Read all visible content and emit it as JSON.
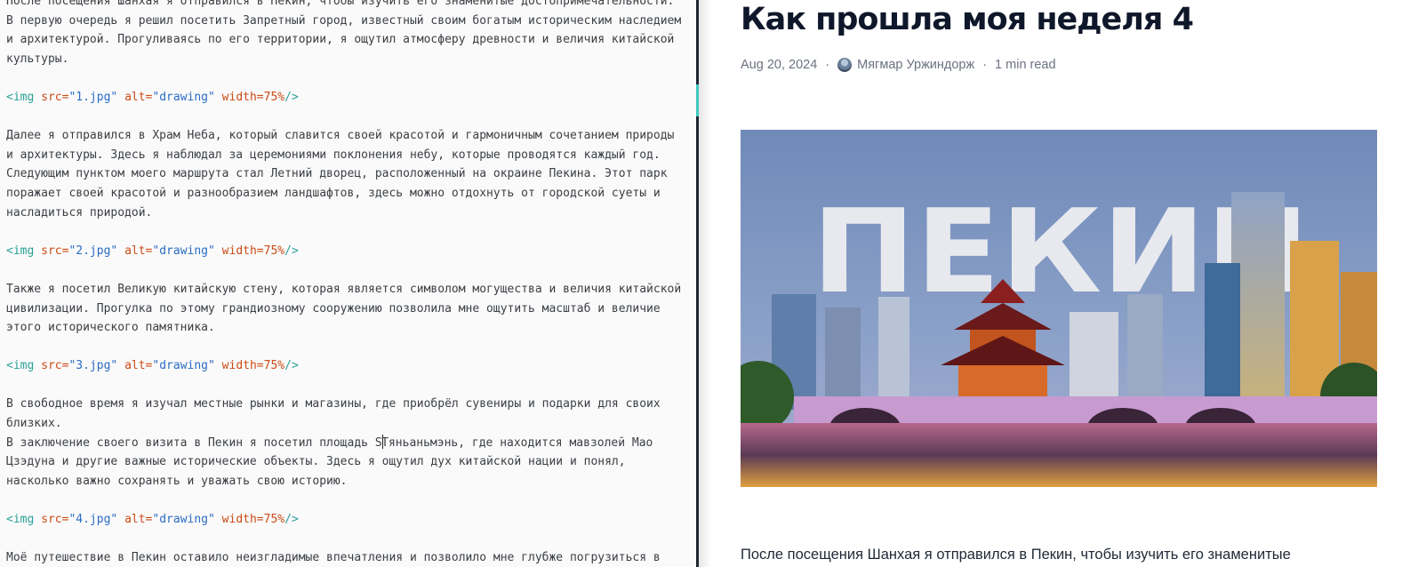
{
  "editor": {
    "lines": [
      [
        {
          "t": "plain",
          "v": "После посещения Шанхая я отправился в Пекин, чтобы изучить его знаменитые достопримечательности."
        }
      ],
      [
        {
          "t": "plain",
          "v": "В первую очередь я решил посетить Запретный город, известный своим богатым историческим наследием"
        }
      ],
      [
        {
          "t": "plain",
          "v": "и архитектурой. Прогуливаясь по его территории, я ощутил атмосферу древности и величия китайской"
        }
      ],
      [
        {
          "t": "plain",
          "v": "культуры."
        }
      ],
      [],
      [
        {
          "t": "tag",
          "v": "<img "
        },
        {
          "t": "attr",
          "v": "src="
        },
        {
          "t": "str",
          "v": "\"1.jpg\""
        },
        {
          "t": "plain",
          "v": " "
        },
        {
          "t": "attr",
          "v": "alt="
        },
        {
          "t": "str",
          "v": "\"drawing\""
        },
        {
          "t": "plain",
          "v": " "
        },
        {
          "t": "attr",
          "v": "width="
        },
        {
          "t": "attr",
          "v": "75%"
        },
        {
          "t": "tag",
          "v": "/>"
        }
      ],
      [],
      [
        {
          "t": "plain",
          "v": "Далее я отправился в Храм Неба, который славится своей красотой и гармоничным сочетанием природы"
        }
      ],
      [
        {
          "t": "plain",
          "v": "и архитектуры. Здесь я наблюдал за церемониями поклонения небу, которые проводятся каждый год."
        }
      ],
      [
        {
          "t": "plain",
          "v": "Следующим пунктом моего маршрута стал Летний дворец, расположенный на окраине Пекина. Этот парк"
        }
      ],
      [
        {
          "t": "plain",
          "v": "поражает своей красотой и разнообразием ландшафтов, здесь можно отдохнуть от городской суеты и"
        }
      ],
      [
        {
          "t": "plain",
          "v": "насладиться природой."
        }
      ],
      [],
      [
        {
          "t": "tag",
          "v": "<img "
        },
        {
          "t": "attr",
          "v": "src="
        },
        {
          "t": "str",
          "v": "\"2.jpg\""
        },
        {
          "t": "plain",
          "v": " "
        },
        {
          "t": "attr",
          "v": "alt="
        },
        {
          "t": "str",
          "v": "\"drawing\""
        },
        {
          "t": "plain",
          "v": " "
        },
        {
          "t": "attr",
          "v": "width="
        },
        {
          "t": "attr",
          "v": "75%"
        },
        {
          "t": "tag",
          "v": "/>"
        }
      ],
      [],
      [
        {
          "t": "plain",
          "v": "Также я посетил Великую китайскую стену, которая является символом могущества и величия китайской"
        }
      ],
      [
        {
          "t": "plain",
          "v": "цивилизации. Прогулка по этому грандиозному сооружению позволила мне ощутить масштаб и величие"
        }
      ],
      [
        {
          "t": "plain",
          "v": "этого исторического памятника."
        }
      ],
      [],
      [
        {
          "t": "tag",
          "v": "<img "
        },
        {
          "t": "attr",
          "v": "src="
        },
        {
          "t": "str",
          "v": "\"3.jpg\""
        },
        {
          "t": "plain",
          "v": " "
        },
        {
          "t": "attr",
          "v": "alt="
        },
        {
          "t": "str",
          "v": "\"drawing\""
        },
        {
          "t": "plain",
          "v": " "
        },
        {
          "t": "attr",
          "v": "width="
        },
        {
          "t": "attr",
          "v": "75%"
        },
        {
          "t": "tag",
          "v": "/>"
        }
      ],
      [],
      [
        {
          "t": "plain",
          "v": "В свободное время я изучал местные рынки и магазины, где приобрёл сувениры и подарки для своих"
        }
      ],
      [
        {
          "t": "plain",
          "v": "близких."
        }
      ],
      [
        {
          "t": "plain",
          "v": "В заключение своего визита в Пекин я посетил площадь S"
        },
        {
          "t": "caret",
          "v": ""
        },
        {
          "t": "plain",
          "v": "Тяньаньмэнь, где находится мавзолей Мао"
        }
      ],
      [
        {
          "t": "plain",
          "v": "Цзэдуна и другие важные исторические объекты. Здесь я ощутил дух китайской нации и понял,"
        }
      ],
      [
        {
          "t": "plain",
          "v": "насколько важно сохранять и уважать свою историю."
        }
      ],
      [],
      [
        {
          "t": "tag",
          "v": "<img "
        },
        {
          "t": "attr",
          "v": "src="
        },
        {
          "t": "str",
          "v": "\"4.jpg\""
        },
        {
          "t": "plain",
          "v": " "
        },
        {
          "t": "attr",
          "v": "alt="
        },
        {
          "t": "str",
          "v": "\"drawing\""
        },
        {
          "t": "plain",
          "v": " "
        },
        {
          "t": "attr",
          "v": "width="
        },
        {
          "t": "attr",
          "v": "75%"
        },
        {
          "t": "tag",
          "v": "/>"
        }
      ],
      [],
      [
        {
          "t": "plain",
          "v": "Моё путешествие в Пекин оставило неизгладимые впечатления и позволило мне глубже погрузиться в"
        }
      ]
    ]
  },
  "preview": {
    "title": "Как прошла моя неделя 4",
    "date": "Aug 20, 2024",
    "author": "Мягмар Уржиндорж",
    "read_time": "1 min read",
    "hero_text": "ПЕКИН",
    "lead": "После посещения Шанхая я отправился в Пекин, чтобы изучить его знаменитые"
  },
  "colors": {
    "syntax_tag": "#2aa198",
    "syntax_attr": "#cb4b16",
    "syntax_string": "#2b6cc4",
    "divider_accent": "#3ec9c0"
  },
  "icons": {
    "author_avatar": "avatar-icon",
    "text_caret": "text-cursor"
  }
}
